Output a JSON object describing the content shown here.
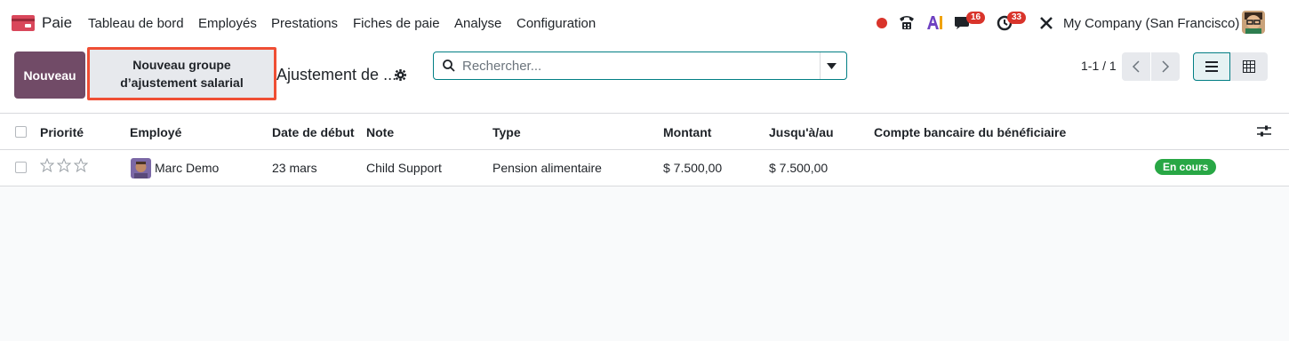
{
  "navbar": {
    "app_name": "Paie",
    "menu": [
      "Tableau de bord",
      "Employés",
      "Prestations",
      "Fiches de paie",
      "Analyse",
      "Configuration"
    ],
    "messages_count": "16",
    "activities_count": "33",
    "company": "My Company (San Francisco)"
  },
  "control": {
    "new_label": "Nouveau",
    "new_group_label": "Nouveau groupe d’ajustement salarial",
    "breadcrumb": "Ajustement de ...",
    "search_placeholder": "Rechercher...",
    "pager": "1-1 / 1"
  },
  "table": {
    "headers": {
      "priority": "Priorité",
      "employee": "Employé",
      "start_date": "Date de début",
      "note": "Note",
      "type": "Type",
      "amount": "Montant",
      "until": "Jusqu'à/au",
      "bank_account": "Compte bancaire du bénéficiaire"
    },
    "rows": [
      {
        "priority_stars": 0,
        "employee": "Marc Demo",
        "start_date": "23 mars",
        "note": "Child Support",
        "type": "Pension alimentaire",
        "amount": "$ 7.500,00",
        "until": "$ 7.500,00",
        "bank_account": "",
        "status": "En cours"
      }
    ]
  },
  "colors": {
    "primary": "#714b67",
    "highlight_border": "#ef4e34",
    "status_green": "#28a745",
    "badge_red": "#d9342b",
    "search_border": "#017e84"
  }
}
